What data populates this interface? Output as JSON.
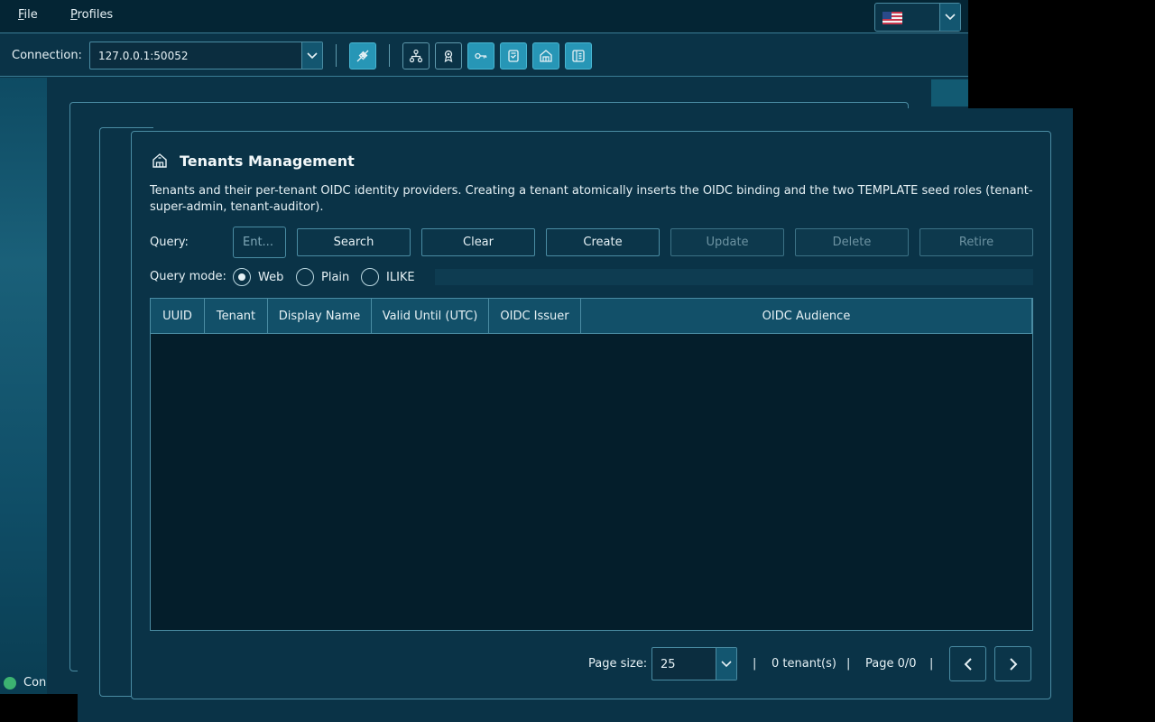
{
  "menubar": {
    "file": {
      "mnemonic": "F",
      "rest": "ile"
    },
    "profiles": {
      "mnemonic": "P",
      "rest": "rofiles"
    }
  },
  "language": {
    "selected_icon": "us-flag-icon"
  },
  "toolbar": {
    "connection_label": "Connection:",
    "connection_value": "127.0.0.1:50052",
    "buttons": [
      {
        "icon": "disconnect-icon",
        "active": true
      },
      {
        "icon": "org-tree-icon",
        "active": false
      },
      {
        "icon": "badge-icon",
        "active": false
      },
      {
        "icon": "key-icon",
        "active": true
      },
      {
        "icon": "policy-icon",
        "active": true
      },
      {
        "icon": "tenants-icon",
        "active": true
      },
      {
        "icon": "audit-log-icon",
        "active": true
      }
    ]
  },
  "status": {
    "text": "Connected"
  },
  "dialog": {
    "title": "Tenants Management",
    "description": "Tenants and their per-tenant OIDC identity providers. Creating a tenant atomically inserts the OIDC binding and the two TEMPLATE seed roles (tenant-super-admin, tenant-auditor).",
    "query_label": "Query:",
    "query_placeholder": "Ent...",
    "query_value": "",
    "actions": {
      "search": "Search",
      "clear": "Clear",
      "create": "Create",
      "update": "Update",
      "delete": "Delete",
      "retire": "Retire"
    },
    "query_mode": {
      "label": "Query mode:",
      "options": [
        "Web",
        "Plain",
        "ILIKE"
      ],
      "selected": "Web"
    },
    "table": {
      "columns": [
        "UUID",
        "Tenant",
        "Display Name",
        "Valid Until (UTC)",
        "OIDC Issuer",
        "OIDC Audience"
      ],
      "rows": []
    },
    "pager": {
      "page_size_label": "Page size:",
      "page_size": "25",
      "separator": "|",
      "count": "0 tenant(s)",
      "page": "Page 0/0"
    }
  },
  "colors": {
    "background": "#0a3347",
    "border": "#4a8ca3",
    "accent": "#2796b6",
    "table_header": "#125069",
    "table_body": "#041e2b"
  }
}
